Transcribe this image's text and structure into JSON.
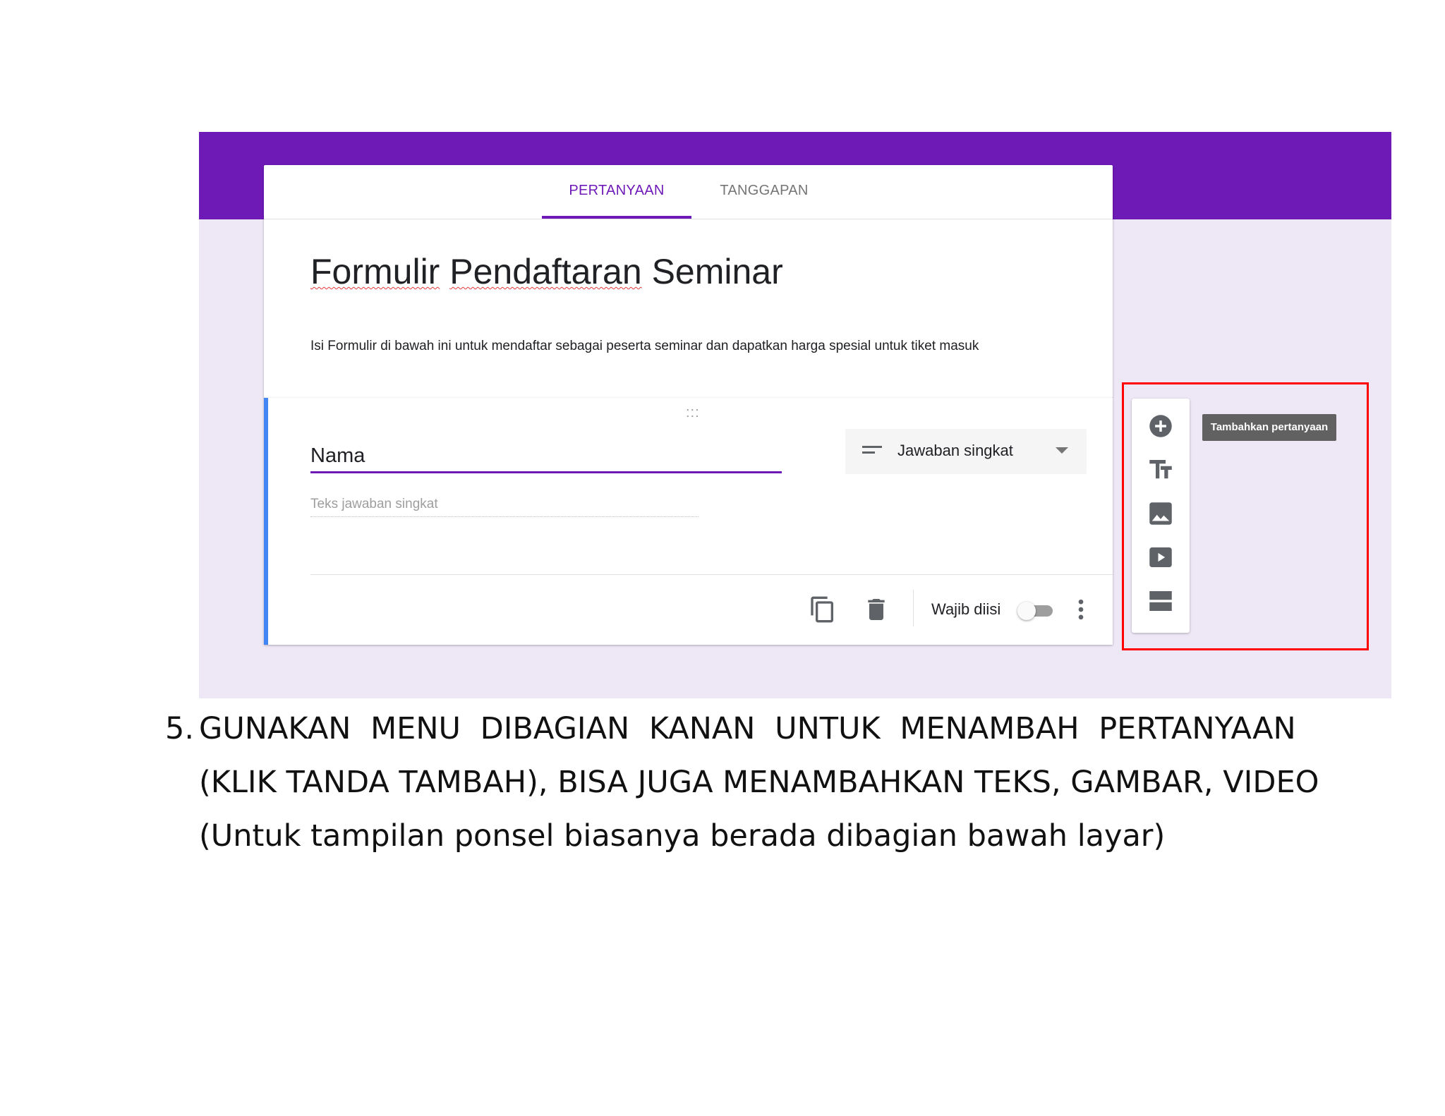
{
  "colors": {
    "brand": "#6e1ab7",
    "background": "#ede7f6",
    "highlight": "#ff0000",
    "accent_left": "#4285f4"
  },
  "tabs": [
    {
      "label": "PERTANYAAN",
      "active": true
    },
    {
      "label": "TANGGAPAN",
      "active": false
    }
  ],
  "form": {
    "title_words": [
      "Formulir",
      "Pendaftaran",
      "Seminar"
    ],
    "description": "Isi Formulir di bawah ini untuk mendaftar sebagai peserta seminar dan dapatkan harga spesial untuk tiket masuk"
  },
  "question": {
    "drag_handle": ":::",
    "title": "Nama",
    "type_label": "Jawaban singkat",
    "answer_placeholder": "Teks jawaban singkat",
    "required_label": "Wajib diisi",
    "required": false
  },
  "toolbar": {
    "tooltip": "Tambahkan pertanyaan",
    "tools": [
      "add-circle-icon",
      "title-text-icon",
      "image-icon",
      "video-icon",
      "section-icon"
    ]
  },
  "caption": {
    "number": "5.",
    "line1": "GUNAKAN MENU DIBAGIAN KANAN UNTUK MENAMBAH PERTANYAAN",
    "line2": "(KLIK TANDA TAMBAH), BISA JUGA MENAMBAHKAN TEKS, GAMBAR, VIDEO",
    "line3": "(Untuk tampilan ponsel biasanya berada dibagian bawah layar)"
  }
}
